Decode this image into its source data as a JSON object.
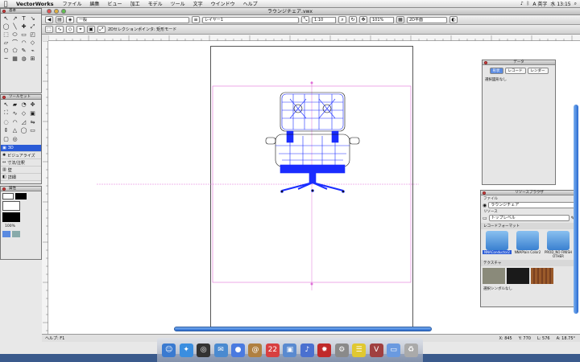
{
  "menubar": {
    "apple": "",
    "app": "VectorWorks",
    "items": [
      "ファイル",
      "編集",
      "ビュー",
      "加工",
      "モデル",
      "ツール",
      "文字",
      "ウインドウ",
      "ヘルプ"
    ],
    "input_method": "A 英字",
    "clock": "水 13:15"
  },
  "window": {
    "title": "ラウンジチェア.vwx"
  },
  "toolbar1": {
    "class_select": "一般",
    "layer_select": "レイヤー1",
    "scale": "1:10",
    "zoom": "101%",
    "view": "2D平面"
  },
  "toolbar2": {
    "mode_text": "2Dセレクションポインタ: 矩形モード"
  },
  "tool_palette": {
    "title": "基本",
    "tools": [
      "↖",
      "↗",
      "T",
      "↘",
      "◯",
      "╲",
      "✚",
      "⤢",
      "⬚",
      "⬭",
      "▭",
      "◰",
      "▱",
      "⌒",
      "◠",
      "◇",
      "⬡",
      "⬠",
      "✎",
      "⌁",
      "~",
      "▦",
      "◍",
      "⊞"
    ]
  },
  "tool_sets": {
    "title": "ツールセット",
    "items": [
      {
        "label": "3D",
        "active": true
      },
      {
        "label": "ビジュアライズ",
        "active": false
      },
      {
        "label": "寸法/注釈",
        "active": false
      },
      {
        "label": "壁",
        "active": false
      },
      {
        "label": "詳細",
        "active": false
      }
    ]
  },
  "attributes": {
    "title": "属性",
    "zoom": "100%"
  },
  "data_palette": {
    "title": "データ",
    "tabs": [
      "形状",
      "レコード",
      "レンダー"
    ],
    "active_tab": "形状",
    "label": "選択図形なし"
  },
  "resource_browser": {
    "title": "リソースブラウザ",
    "file_label": "ファイル",
    "file_value": "ラウンジチェア",
    "resource_label": "リソース",
    "resource_value": "トップレベル",
    "section1": "レコードフォーマット",
    "items": [
      "NNAConductor2",
      "NNAPlain Color2",
      "PROD_NO FINISH OTHER"
    ],
    "section2": "テクスチャ",
    "status": "選択シンボルなし",
    "textures": [
      "#8a8a7a",
      "#1a1a1a",
      "#9a5a2a"
    ]
  },
  "status": {
    "help": "ヘルプ: F1",
    "x": "X: 845",
    "y": "Y: 770",
    "l": "L: 576",
    "a": "A: 18.75°"
  },
  "colors": {
    "accent": "#2a5bd7",
    "chair": "#1a2cff",
    "guide": "#e070d8"
  },
  "dock": {
    "icons": [
      {
        "name": "finder-icon",
        "color": "#3a7ad0",
        "glyph": "☺"
      },
      {
        "name": "safari-icon",
        "color": "#3a8ee0",
        "glyph": "✦"
      },
      {
        "name": "dashboard-icon",
        "color": "#333",
        "glyph": "◎"
      },
      {
        "name": "mail-icon",
        "color": "#4a8ad0",
        "glyph": "✉"
      },
      {
        "name": "ichat-icon",
        "color": "#4a7ae0",
        "glyph": "●"
      },
      {
        "name": "address-book-icon",
        "color": "#b08040",
        "glyph": "@"
      },
      {
        "name": "ical-icon",
        "color": "#d84040",
        "glyph": "22"
      },
      {
        "name": "iphoto-icon",
        "color": "#5a8ad0",
        "glyph": "▣"
      },
      {
        "name": "itunes-icon",
        "color": "#4a70d0",
        "glyph": "♪"
      },
      {
        "name": "system-icon",
        "color": "#c02a2a",
        "glyph": "✹"
      },
      {
        "name": "preferences-icon",
        "color": "#8a8a8a",
        "glyph": "⚙"
      },
      {
        "name": "stickies-icon",
        "color": "#e0c830",
        "glyph": "☰"
      },
      {
        "name": "vectorworks-icon",
        "color": "#a04040",
        "glyph": "V"
      },
      {
        "name": "folder-icon",
        "color": "#6a9ae0",
        "glyph": "▭"
      },
      {
        "name": "trash-icon",
        "color": "#aaa",
        "glyph": "♻"
      }
    ]
  }
}
